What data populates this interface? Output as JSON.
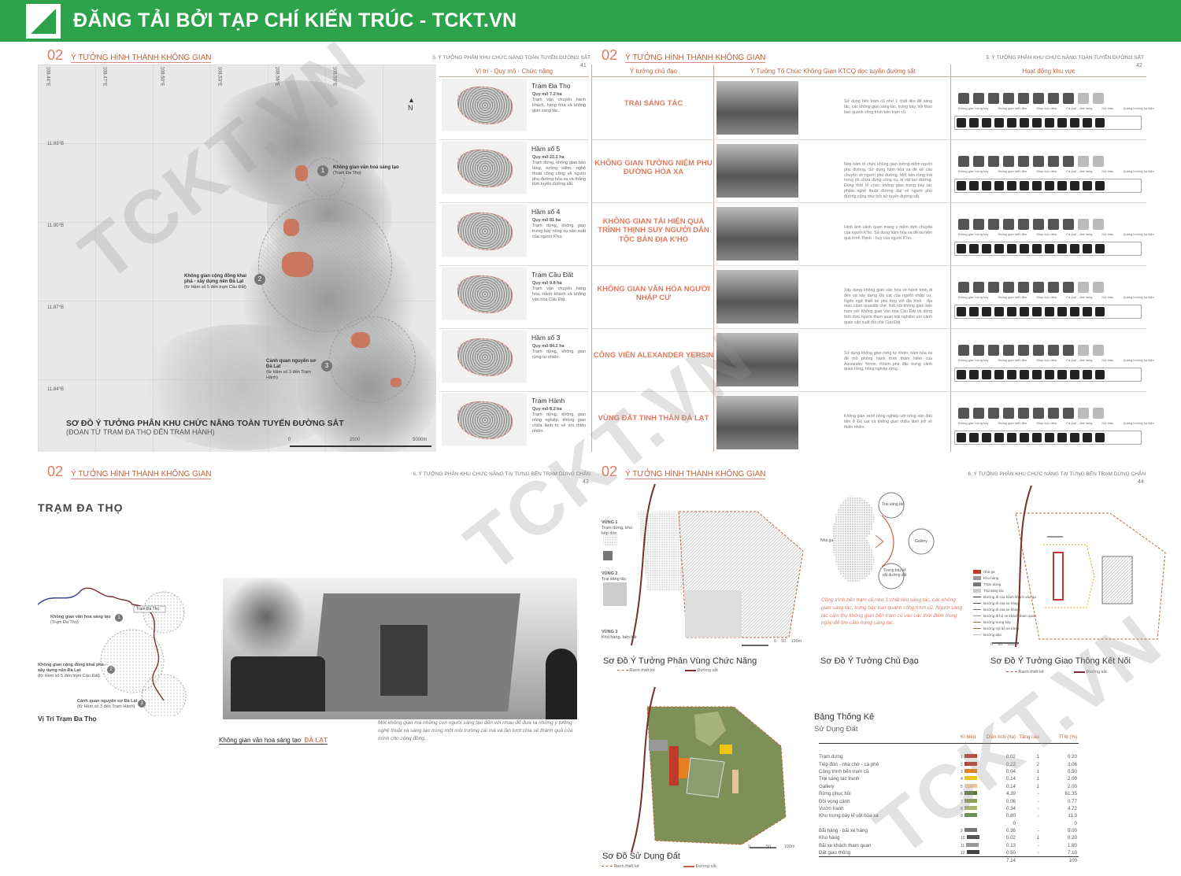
{
  "banner": {
    "title": "ĐĂNG TẢI BỞI TẠP CHÍ KIẾN TRÚC - TCKT.VN"
  },
  "watermark": "TCKT.VN",
  "sec": {
    "num": "02",
    "title": "Ý TƯỞNG HÌNH THÀNH KHÔNG GIAN"
  },
  "p41": {
    "right": "5. Ý TƯỞNG PHÂN KHU CHỨC NĂNG TOÀN TUYẾN ĐƯỜNG SẮT",
    "page": "41",
    "map_title": "SƠ ĐỒ Ý TƯỞNG PHÂN KHU CHỨC NĂNG TOÀN TUYẾN ĐƯỜNG SẮT",
    "map_sub": "(ĐOẠN TỪ TRẠM ĐA THỌ ĐẾN TRẠM HÀNH)",
    "coords": [
      "108.44°E",
      "108.47°E",
      "108.50°E",
      "108.53°E",
      "108.56°E",
      "108.59°E",
      "11.93°B",
      "11.90°B",
      "11.87°B",
      "11.84°B"
    ],
    "scale": [
      "0",
      "2500",
      "5000m"
    ],
    "labels": [
      {
        "n": "1",
        "t": "Không gian văn hoá sáng tạo",
        "s": "(Trạm Đa Thọ)"
      },
      {
        "n": "2",
        "t": "Không gian cộng đồng khai phá - xây dựng nên Đà Lạt",
        "s": "(từ Hầm số 5 đến trạm Cầu Đất)"
      },
      {
        "n": "3",
        "t": "Cảnh quan nguyên sơ Đà Lạt",
        "s": "(từ Hầm số 3 đến Trạm Hành)"
      }
    ],
    "col": "Vị trí - Quy mô - Chức năng",
    "rows": [
      {
        "name": "Trạm Đa Thọ",
        "scale": "Quy mô 7.2 ha",
        "desc": "Trạm vận chuyển hành khách, hàng hóa và không gian sáng tác."
      },
      {
        "name": "Hầm số 5",
        "scale": "Quy mô 22.2 ha",
        "desc": "Trạm dừng, không gian bảo tàng, tưởng niệm, nghệ thuật công cộng về người phu đường hỏa xa và thắng tâm tuyến đường sắt."
      },
      {
        "name": "Hầm số 4",
        "scale": "Quy mô 81 ha",
        "desc": "Trạm dừng, không gian trưng bày nông cụ sản xuất của người K'ho."
      },
      {
        "name": "Trạm Cầu Đất",
        "scale": "Quy mô 9.8 ha",
        "desc": "Trạm vận chuyển hàng hóa, hành khách và không văn hóa Cầu Đất."
      },
      {
        "name": "Hầm số 3",
        "scale": "Quy mô 84.2 ha",
        "desc": "Trạm dừng, không gian rừng tự nhiên."
      },
      {
        "name": "Trạm Hành",
        "scale": "Quy mô 8.2 ha",
        "desc": "Trạm dừng, không gian nông nghiệp, không gian chữa lành trị về với thiên nhiên."
      }
    ]
  },
  "p42": {
    "right": "5. Ý TƯỞNG PHÂN KHU CHỨC NĂNG TOÀN TUYẾN ĐƯỜNG SẮT",
    "page": "42",
    "cols": [
      "Ý tưởng chủ đạo",
      "Ý Tưởng Tổ Chức Không Gian KTCQ dọc tuyến đường sắt",
      "Hoạt động khu vực"
    ],
    "ideas": [
      "TRẠI SÁNG TÁC",
      "KHÔNG GIAN TƯỞNG NIỆM PHU ĐƯỜNG HỎA XA",
      "KHÔNG GIAN TÁI HIỆN QUÁ TRÌNH THỊNH SUY NGƯỜI DÂN TỘC BẢN ĐỊA K'HO",
      "KHÔNG GIAN VĂN HÓA NGƯỜI NHẬP CƯ",
      "CÔNG VIÊN ALEXANDER YERSIN",
      "VÙNG ĐẤT TINH THẦN ĐÀ LẠT"
    ],
    "descs": [
      "Sử dụng bến trạm cũ như 1 chất liệu để sáng tác, các không gian sáng tác, trưng bày, hội thảo bao quanh công trình bến trạm cũ.",
      "Nép hầm tổ chức không gian tưởng niệm người phu đường. Sử dụng hầm hỏa xa để kể câu chuyện về người phu đường. Một bên rừng trải trong đó chứa đựng công cụ, kỉ vật lao đường. Đồng thời tổ chức không gian trưng bày tác phẩm nghệ thuật đương đại về người phu đường cũng như lịch sử tuyến đường sắt.",
      "Hình ảnh cảnh quan mang ý niệm dịch chuyển của người K'ho. Sử dụng hầm hỏa xa để tái hiện quá trình Thịnh - Suy của người K'ho.",
      "Xây dựng không gian văn hóa về hành trình đi đến và xây dựng Đà Lạt của người nhập cư. Ngôn ngữ thiết kế phù hợp với địa hình - địa mạo cảnh quanđồi chè. Kết nối không gian bến trạm với Không gian văn hóa Cầu Đất và đồng thời đưa người tham quan trải nghiệm với cảnh quan sản xuất đồi chè Cầu Đất.",
      "Sử dụng không gian rừng tự nhiên, hầm hỏa xa để mô phỏng hành trình thám hiểm của Alexander Yersin. Khám phá đặc trưng cảnh quan rừng, nông nghiệp rừng.",
      "Không gian xanh nông nghiệp với nông sản đầu tiên ở Đà Lạt và không gian chữa lành trở về thiên nhiên."
    ],
    "act_labels": [
      "Không gian trưng bày",
      "Không gian triển lãm",
      "Shop lưu niệm",
      "Cà phê - nhà hàng",
      "Hội thảo",
      "Quảng trường sự kiện"
    ]
  },
  "p43": {
    "right": "6. Ý TƯỞNG PHÂN KHU CHỨC NĂNG TẠI TỪNG BẾN TRẠM DỪNG CHÂN",
    "page": "43",
    "title": "TRẠM ĐA THỌ",
    "labels": [
      {
        "t": "Không gian văn hoá sáng tạo",
        "s": "(Trạm Đa Thọ)"
      },
      {
        "t": "Không gian cộng đồng khai phá - xây dựng nên Đà Lạt",
        "s": "(từ Hầm số 5 đến trạm Cầu Đất)"
      },
      {
        "t": "Cảnh quan nguyên sơ Đà Lạt",
        "s": "(từ Hầm số 3 đến Trạm Hành)"
      }
    ],
    "tag": "Trạm Đa Thọ",
    "loc_cap": "Vị Trí Trạm Đa Thọ",
    "photo_cap": "Không gian văn hoa sáng tạo",
    "photo_cap2": "ĐÀ LẠT",
    "note": "Một không gian mà những con người sáng tạo đến với nhau để đưa ra những ý tưởng nghệ thuật và sáng tạo trong một môi trường cái mà và lần lượt chia sẻ thành quả của mình cho cộng đồng."
  },
  "p44": {
    "right": "6. Ý TƯỞNG PHÂN KHU CHỨC NĂNG TẠI TỪNG BẾN TRẠM DỪNG CHÂN",
    "page": "44",
    "zones": [
      {
        "t": "VÙNG 1",
        "s": "Trạm dừng, khu tiếp đón"
      },
      {
        "t": "VÙNG 2",
        "s": "Trại sáng tác"
      },
      {
        "t": "VÙNG 3",
        "s": "Kho hàng, bến bãi"
      }
    ],
    "cap1": "Sơ Đồ Ý Tưởng Phân Vùng Chức Năng",
    "cap2": "Sơ Đồ Ý Tưởng Chủ Đạo",
    "cap3": "Sơ Đồ Ý Tưởng Giao Thông Kết Nối",
    "cap4": "Sơ Đồ Sử Dụng Đất",
    "leg_a": "Ranh thiết kế",
    "leg_b": "Đường sắt",
    "idea_nodes": [
      "Trại sáng tác",
      "Gallery",
      "Trưng bày kỉ vật đường sắt",
      "Nhà ga"
    ],
    "idea_note": "Công trình bến trạm cũ như 1 chất liệu sáng tác, các không gian sáng tác, trưng bày bao quanh công trình cũ. Người sáng tác cảm thụ không gian bến trạm cũ vào các thời điểm trong ngày để tìm cảm hứng sáng tác.",
    "traffic_legend": [
      "Nhà ga",
      "Kho hàng",
      "Trạm dừng",
      "Trại sáng tác",
      "Đường đi của hành khách vào ga",
      "Đường đi của xe hàng",
      "Đường đi của xe khách",
      "Đường đi bộ xe khách tham quan",
      "Đường trưng bày",
      "Đường nội bộ xe hàng",
      "Đường dạo"
    ],
    "scale": [
      "0",
      "50",
      "100m"
    ],
    "stats_title": "Bảng Thống Kê",
    "stats_sub": "Sử Dụng Đất",
    "stats_head": [
      "Kí hiệu",
      "Diện tích (ha)",
      "Tầng cao",
      "Tỉ lệ (%)"
    ],
    "stats": [
      {
        "n": "Trạm dừng",
        "k": "1",
        "a": "0.02",
        "f": "1",
        "p": "0.20",
        "c": "#c0392b"
      },
      {
        "n": "Tiếp đón - nhà chờ - cà phê",
        "k": "2",
        "a": "0.22",
        "f": "2",
        "p": "3.06",
        "c": "#c0392b"
      },
      {
        "n": "Công trình bến trạm cũ",
        "k": "3",
        "a": "0.04",
        "f": "1",
        "p": "0.50",
        "c": "#e67e22"
      },
      {
        "n": "Trại sáng tác tranh",
        "k": "4",
        "a": "0.14",
        "f": "1",
        "p": "2.00",
        "c": "#f1c40f"
      },
      {
        "n": "Gallery",
        "k": "5",
        "a": "0.14",
        "f": "1",
        "p": "2.00",
        "c": "#e8c39e"
      },
      {
        "n": "Rừng phục hồi",
        "k": "6",
        "a": "4.39",
        "f": "-",
        "p": "61.35",
        "c": "#5b7a3a"
      },
      {
        "n": "Đồi vọng cảnh",
        "k": "7",
        "a": "0.06",
        "f": "-",
        "p": "0.77",
        "c": "#8da05a"
      },
      {
        "n": "Vườn tranh",
        "k": "8",
        "a": "0.34",
        "f": "-",
        "p": "4.72",
        "c": "#a7b86e"
      },
      {
        "n": "Khu trưng bày kỉ vật hỏa xa",
        "k": "9",
        "a": "0.80",
        "f": "-",
        "p": "11.3",
        "c": "#6d8f5a"
      },
      {
        "n": "",
        "k": "",
        "a": "0",
        "f": "",
        "p": "0",
        "c": ""
      },
      {
        "n": "Bãi hàng - bãi xe hàng",
        "k": "9",
        "a": "0.36",
        "f": "-",
        "p": "5.00",
        "c": "#777"
      },
      {
        "n": "Kho hàng",
        "k": "10",
        "a": "0.02",
        "f": "1",
        "p": "0.20",
        "c": "#555"
      },
      {
        "n": "Bãi xe khách tham quan",
        "k": "11",
        "a": "0.13",
        "f": "-",
        "p": "1.80",
        "c": "#999"
      },
      {
        "n": "Đất giao thông",
        "k": "12",
        "a": "0.50",
        "f": "-",
        "p": "7.10",
        "c": "#444"
      },
      {
        "n": "",
        "k": "",
        "a": "7.14",
        "f": "",
        "p": "100",
        "c": ""
      }
    ]
  }
}
